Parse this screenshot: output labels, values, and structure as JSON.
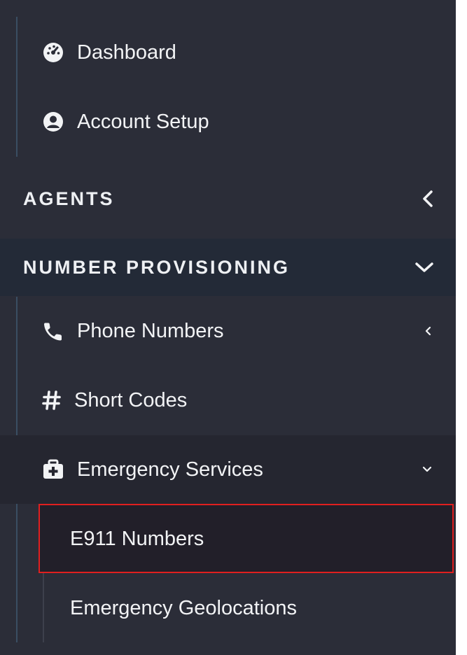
{
  "menu": {
    "dashboard": {
      "label": "Dashboard",
      "icon": "tachometer-icon"
    },
    "account_setup": {
      "label": "Account Setup",
      "icon": "user-circle-icon"
    },
    "agents": {
      "label": "AGENTS",
      "state": "collapsed"
    },
    "number_provisioning": {
      "label": "NUMBER PROVISIONING",
      "state": "expanded",
      "items": [
        {
          "label": "Phone Numbers",
          "icon": "phone-icon",
          "state": "collapsed"
        },
        {
          "label": "Short Codes",
          "icon": "hashtag-icon"
        },
        {
          "label": "Emergency Services",
          "icon": "medkit-icon",
          "state": "expanded",
          "children": [
            {
              "label": "E911 Numbers",
              "active": true
            },
            {
              "label": "Emergency Geolocations"
            }
          ]
        }
      ]
    }
  },
  "colors": {
    "sidebar_bg": "#2b2d38",
    "section_active_bg": "#232a37",
    "submenu_bg": "#252630",
    "active_item_bg": "#221f29",
    "highlight_border": "#e01f1f"
  }
}
